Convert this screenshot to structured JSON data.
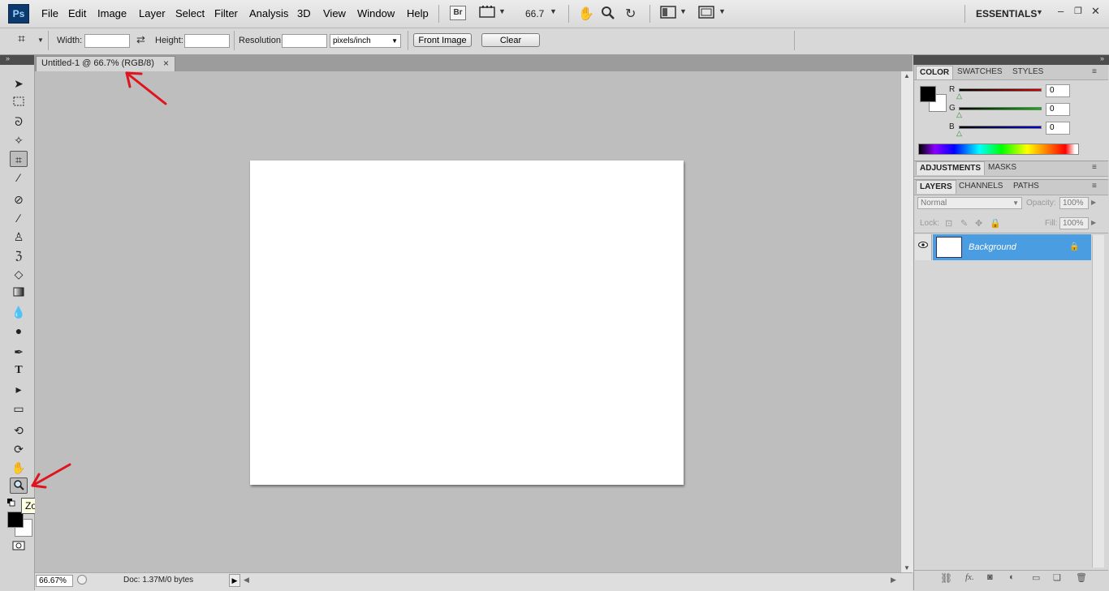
{
  "app": {
    "logo": "Ps"
  },
  "menu": [
    "File",
    "Edit",
    "Image",
    "Layer",
    "Select",
    "Filter",
    "Analysis",
    "3D",
    "View",
    "Window",
    "Help"
  ],
  "toolbar_top": {
    "bridge_label": "Br",
    "zoom_value": "66.7",
    "workspace": "ESSENTIALS"
  },
  "options": {
    "width_label": "Width:",
    "height_label": "Height:",
    "resolution_label": "Resolution:",
    "resolution_unit": "pixels/inch",
    "front_image_label": "Front Image",
    "clear_label": "Clear"
  },
  "document": {
    "tab_title": "Untitled-1 @ 66.7% (RGB/8)",
    "close_glyph": "×"
  },
  "status": {
    "zoom": "66.67%",
    "doc_info": "Doc: 1.37M/0 bytes"
  },
  "tooltip": {
    "text": "Zoom Tool (Z)"
  },
  "color_panel": {
    "tabs": [
      "COLOR",
      "SWATCHES",
      "STYLES"
    ],
    "channels": [
      {
        "label": "R",
        "value": "0",
        "color": "#d00000"
      },
      {
        "label": "G",
        "value": "0",
        "color": "#00c000"
      },
      {
        "label": "B",
        "value": "0",
        "color": "#0000d0"
      }
    ]
  },
  "adjustments_panel": {
    "tabs": [
      "ADJUSTMENTS",
      "MASKS"
    ]
  },
  "layers_panel": {
    "tabs": [
      "LAYERS",
      "CHANNELS",
      "PATHS"
    ],
    "blend_mode": "Normal",
    "opacity_label": "Opacity:",
    "opacity_value": "100%",
    "lock_label": "Lock:",
    "fill_label": "Fill:",
    "fill_value": "100%",
    "layers": [
      {
        "name": "Background",
        "visible": true,
        "locked": true
      }
    ]
  },
  "colors": {
    "accent_layer_row": "#4a9de0",
    "annotation_arrow": "#e0141e"
  }
}
